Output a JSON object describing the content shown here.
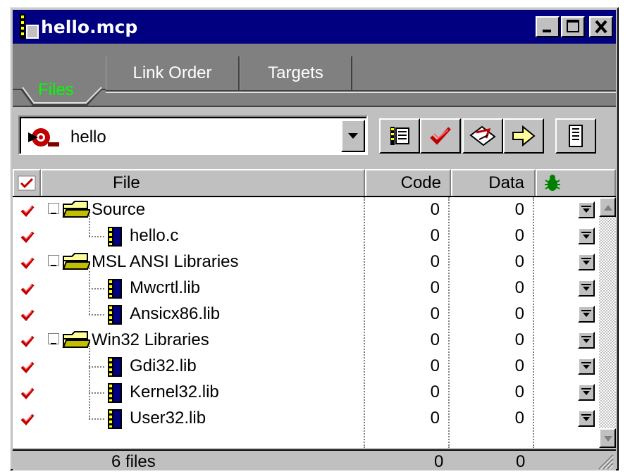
{
  "window": {
    "title": "hello.mcp"
  },
  "tabs": {
    "files": "Files",
    "link_order": "Link Order",
    "targets": "Targets"
  },
  "toolbar": {
    "target_value": "hello"
  },
  "header": {
    "file": "File",
    "code": "Code",
    "data": "Data"
  },
  "rows": [
    {
      "name": "Source",
      "type": "group",
      "code": "0",
      "data": "0"
    },
    {
      "name": "hello.c",
      "type": "file",
      "code": "0",
      "data": "0"
    },
    {
      "name": "MSL ANSI Libraries",
      "type": "group",
      "code": "0",
      "data": "0"
    },
    {
      "name": "Mwcrtl.lib",
      "type": "file",
      "code": "0",
      "data": "0"
    },
    {
      "name": "Ansicx86.lib",
      "type": "file",
      "code": "0",
      "data": "0"
    },
    {
      "name": "Win32 Libraries",
      "type": "group",
      "code": "0",
      "data": "0"
    },
    {
      "name": "Gdi32.lib",
      "type": "file",
      "code": "0",
      "data": "0"
    },
    {
      "name": "Kernel32.lib",
      "type": "file",
      "code": "0",
      "data": "0"
    },
    {
      "name": "User32.lib",
      "type": "file",
      "code": "0",
      "data": "0"
    }
  ],
  "status": {
    "files": "6 files",
    "code_total": "0",
    "data_total": "0"
  },
  "colors": {
    "title_bar": "#000080",
    "active_tab_text": "#00ff00",
    "check": "#c00000"
  }
}
